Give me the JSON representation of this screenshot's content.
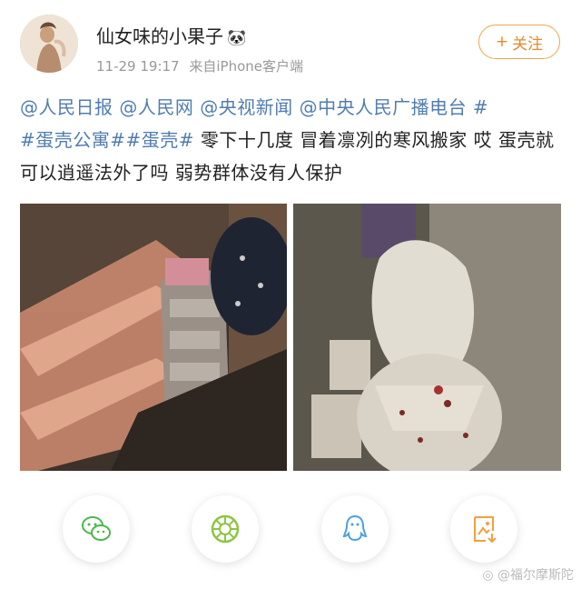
{
  "header": {
    "username": "仙女味的小果子",
    "username_emoji": "🐼",
    "timestamp": "11-29 19:17",
    "source_prefix": "来自",
    "source_device": "iPhone客户端",
    "follow_label": "关注",
    "follow_plus": "+"
  },
  "post": {
    "mentions": [
      "@人民日报",
      "@人民网",
      "@央视新闻",
      "@中央人民广播电台"
    ],
    "hashtags": [
      "#蛋壳公寓#",
      "#蛋壳#"
    ],
    "body": "零下十几度 冒着凛冽的寒风搬家 哎 蛋壳就可以逍遥法外了吗 弱势群体没有人保护"
  },
  "photos": [
    {
      "description_icon": "photo-room-shelf"
    },
    {
      "description_icon": "photo-bags"
    }
  ],
  "share": [
    {
      "icon": "wechat-icon"
    },
    {
      "icon": "moments-icon"
    },
    {
      "icon": "qq-icon"
    },
    {
      "icon": "save-image-icon"
    }
  ],
  "watermark": "@福尔摩斯陀"
}
